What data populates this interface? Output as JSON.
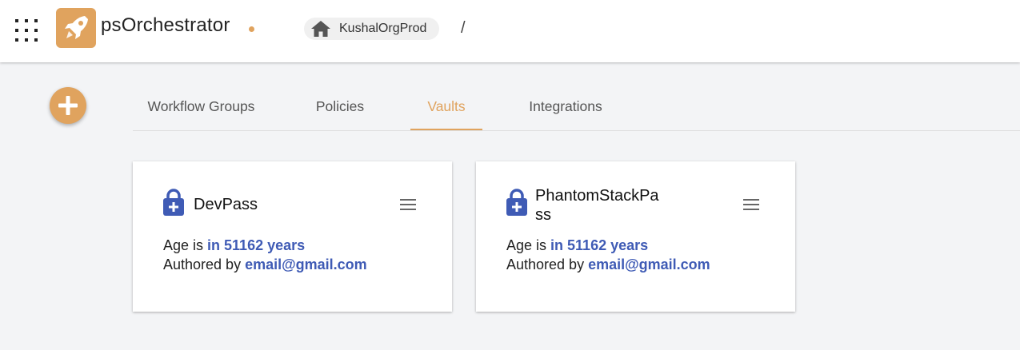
{
  "header": {
    "app_title": "psOrchestrator",
    "breadcrumb": {
      "org": "KushalOrgProd",
      "separator": "/"
    }
  },
  "tabs": [
    {
      "label": "Workflow Groups",
      "active": false
    },
    {
      "label": "Policies",
      "active": false
    },
    {
      "label": "Vaults",
      "active": true
    },
    {
      "label": "Integrations",
      "active": false
    }
  ],
  "vaults": [
    {
      "name": "DevPass",
      "age_prefix": "Age is ",
      "age_value": "in 51162 years",
      "author_prefix": "Authored by ",
      "author": "email@gmail.com"
    },
    {
      "name_line1": "PhantomStackPa",
      "name_line2": "ss",
      "age_prefix": "Age is ",
      "age_value": "in 51162 years",
      "author_prefix": "Authored by ",
      "author": "email@gmail.com"
    }
  ],
  "colors": {
    "accent": "#e0a35e",
    "link": "#3f5bb5",
    "background": "#f3f4f6"
  },
  "icons": [
    "apps-grid-icon",
    "rocket-logo-icon",
    "home-icon",
    "add-icon",
    "lock-icon",
    "hamburger-menu-icon"
  ]
}
